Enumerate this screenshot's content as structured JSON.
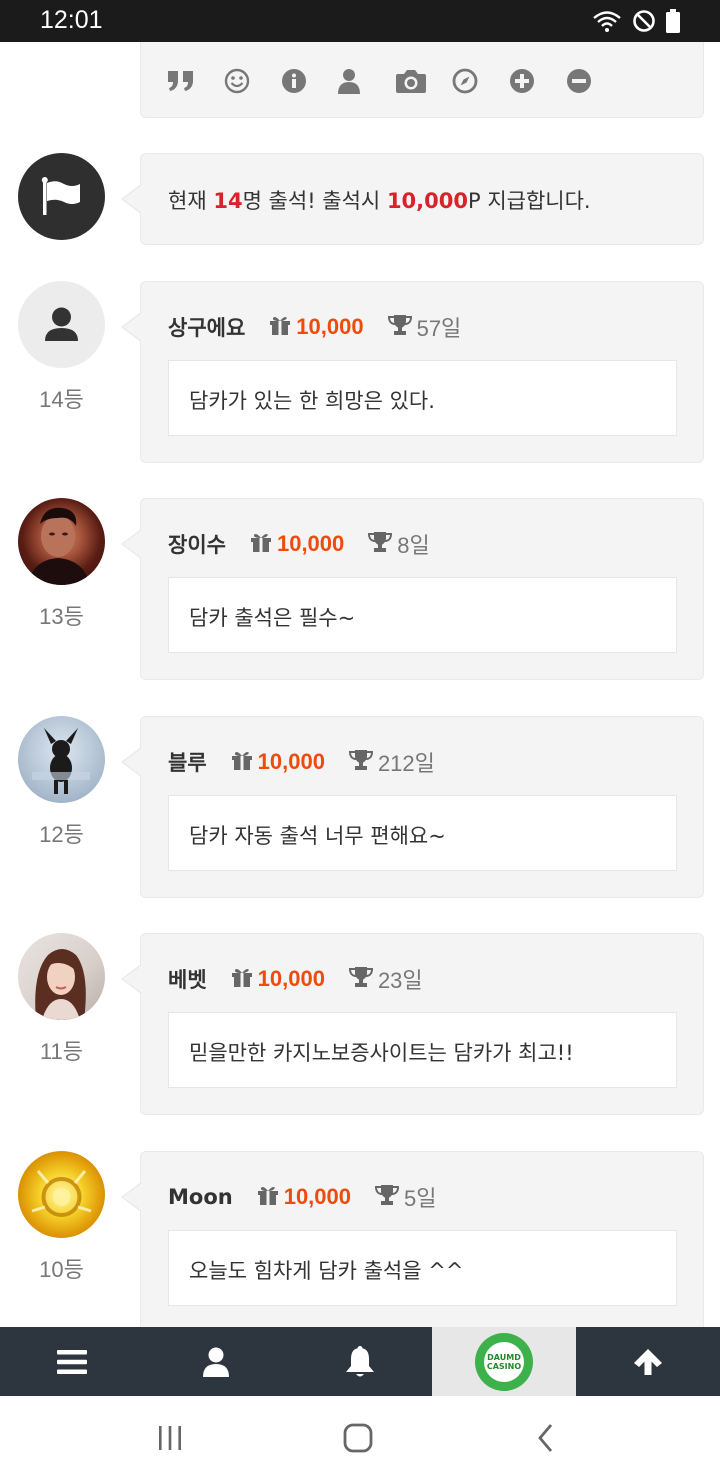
{
  "status_bar": {
    "time": "12:01"
  },
  "toolbar": {
    "icons": [
      "quote-icon",
      "smile-icon",
      "info-icon",
      "user-icon",
      "camera-icon",
      "compass-icon",
      "plus-circle-icon",
      "minus-circle-icon"
    ]
  },
  "notice": {
    "prefix": "현재 ",
    "count": "14",
    "middle": "명 출석! 출석시 ",
    "points": "10,000",
    "suffix": "P 지급합니다."
  },
  "entries": [
    {
      "nickname": "상구에요",
      "points": "10,000",
      "days": "57일",
      "comment": "담카가 있는 한 희망은 있다.",
      "rank": "14등"
    },
    {
      "nickname": "장이수",
      "points": "10,000",
      "days": "8일",
      "comment": "담카 출석은 필수~",
      "rank": "13등"
    },
    {
      "nickname": "블루",
      "points": "10,000",
      "days": "212일",
      "comment": "담카 자동 출석 너무 편해요~",
      "rank": "12등"
    },
    {
      "nickname": "베벳",
      "points": "10,000",
      "days": "23일",
      "comment": "믿을만한 카지노보증사이트는 담카가 최고!!",
      "rank": "11등"
    },
    {
      "nickname": "Moon",
      "points": "10,000",
      "days": "5일",
      "comment": "오늘도 힘차게 담카 출석을 ^^",
      "rank": "10등"
    }
  ],
  "bottom_nav": {
    "items": [
      "menu-icon",
      "user-icon",
      "bell-icon",
      "site-logo",
      "arrow-up-icon"
    ],
    "logo_lines": [
      "DAUMD",
      "CASINO"
    ]
  },
  "colors": {
    "accent_red": "#d8232a",
    "points_orange": "#ee4b0d",
    "nav_bg": "#2d353f"
  }
}
